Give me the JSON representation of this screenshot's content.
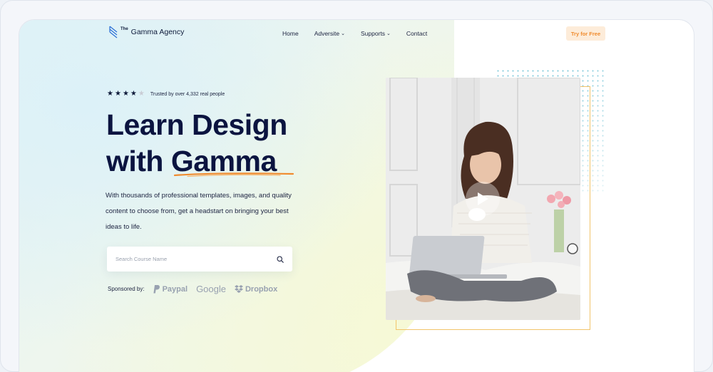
{
  "brand": {
    "small": "The",
    "name": "Gamma Agency",
    "icon": "logo-stripes-icon"
  },
  "nav": {
    "items": [
      {
        "label": "Home",
        "dropdown": false
      },
      {
        "label": "Adversite",
        "dropdown": true
      },
      {
        "label": "Supports",
        "dropdown": true
      },
      {
        "label": "Contact",
        "dropdown": false
      }
    ],
    "cta": "Try for Free"
  },
  "hero": {
    "rating": {
      "stars_filled": 4,
      "stars_total": 5,
      "text": "Trusted by over 4,332 real people"
    },
    "headline_line1": "Learn Design",
    "headline_line2": "with Gamma",
    "description": "With thousands of professional templates, images, and quality content to choose from, get a headstart on bringing your best ideas to life.",
    "search_placeholder": "Search Course Name",
    "sponsored_label": "Sponsored by:",
    "sponsors": [
      "Paypal",
      "Google",
      "Dropbox"
    ]
  },
  "colors": {
    "navy": "#0b1440",
    "accent_orange": "#f08b2e",
    "cta_bg": "#fdecd9",
    "dots": "#7cc7d9",
    "frame_border": "#f2c46b"
  }
}
